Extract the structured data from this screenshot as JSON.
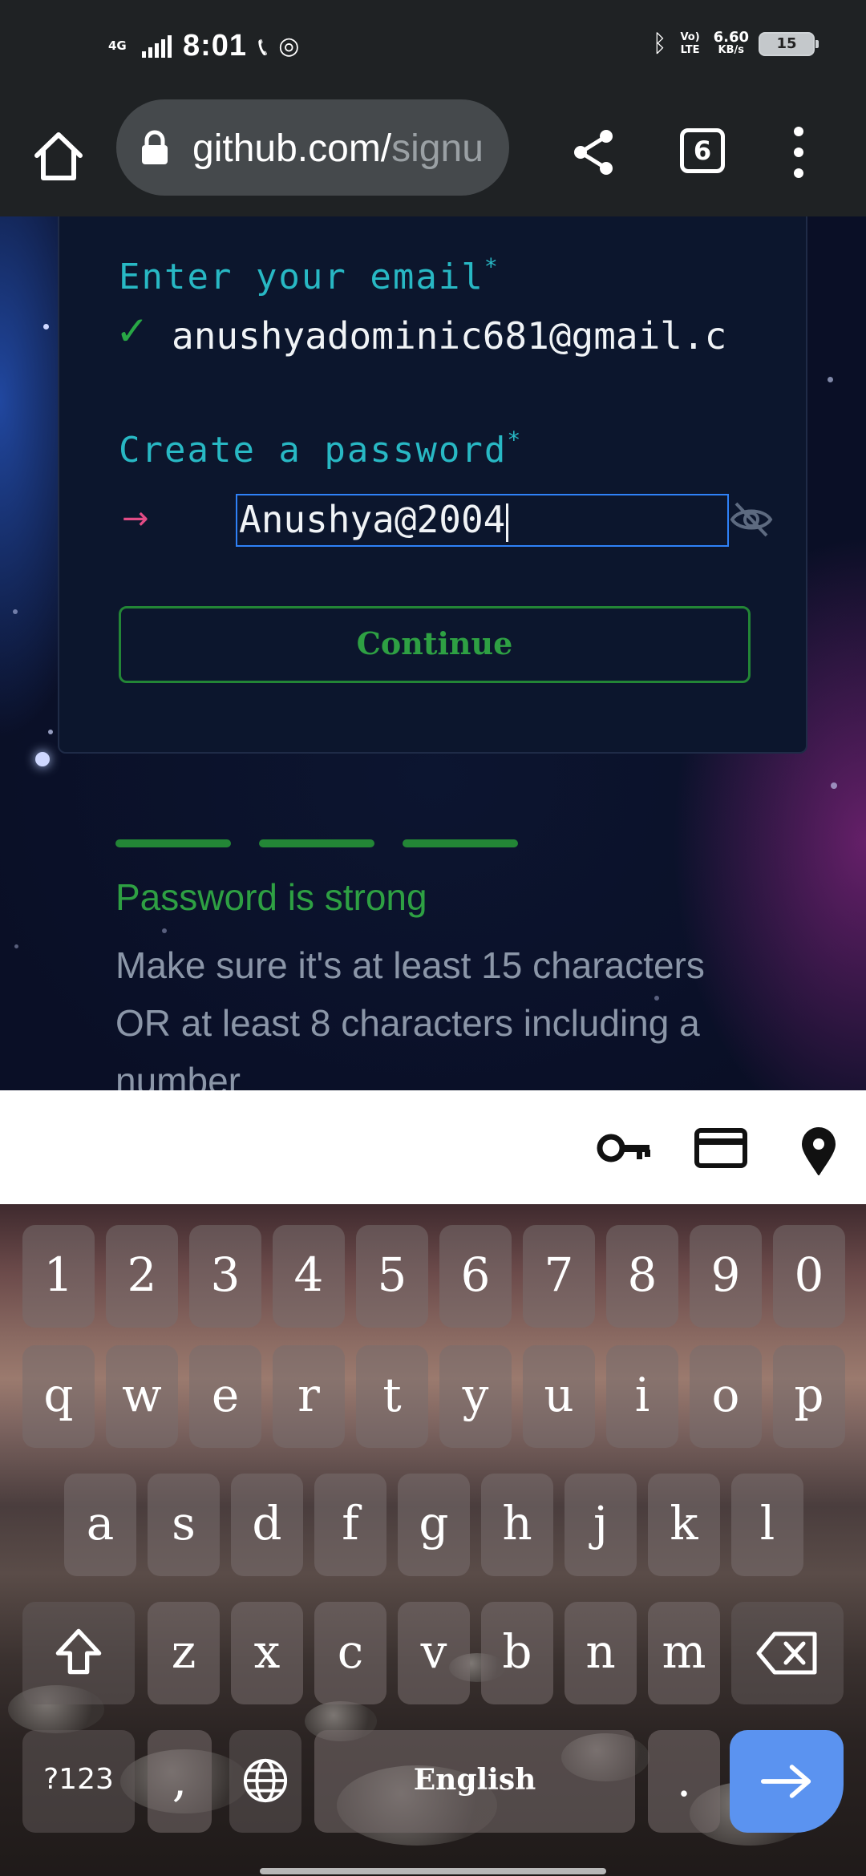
{
  "status_bar": {
    "network": "4G",
    "time": "8:01",
    "volte": "Vo) LTE",
    "speed_value": "6.60",
    "speed_unit": "KB/s",
    "battery": "15"
  },
  "browser": {
    "url_main": "github.com/",
    "url_tail": "signu",
    "tab_count": "6"
  },
  "form": {
    "email_label": "Enter your email",
    "email_required_mark": "*",
    "email_prompt": "✓",
    "email_value": "anushyadominic681@gmail.c",
    "password_label": "Create a password",
    "password_required_mark": "*",
    "password_prompt": "→",
    "password_value": "Anushya@2004",
    "continue_label": "Continue"
  },
  "password_feedback": {
    "strength_segments_filled": 3,
    "strength_segments_total": 3,
    "status": "Password is strong",
    "hint": "Make sure it's at least 15 characters OR at least 8 characters including a number"
  },
  "autofill_bar": {
    "icons": [
      "key-icon",
      "credit-card-icon",
      "location-pin-icon"
    ]
  },
  "keyboard": {
    "row_numbers": [
      "1",
      "2",
      "3",
      "4",
      "5",
      "6",
      "7",
      "8",
      "9",
      "0"
    ],
    "row_top": [
      "q",
      "w",
      "e",
      "r",
      "t",
      "y",
      "u",
      "i",
      "o",
      "p"
    ],
    "row_middle": [
      "a",
      "s",
      "d",
      "f",
      "g",
      "h",
      "j",
      "k",
      "l"
    ],
    "row_bottom": [
      "z",
      "x",
      "c",
      "v",
      "b",
      "n",
      "m"
    ],
    "symbols_label": "?123",
    "comma_label": ",",
    "space_label": "English",
    "period_label": "."
  },
  "colors": {
    "accent_cyan": "#28b8c4",
    "success_green": "#2ea043",
    "focus_blue": "#2f81f7",
    "prompt_pink": "#e34c86"
  }
}
